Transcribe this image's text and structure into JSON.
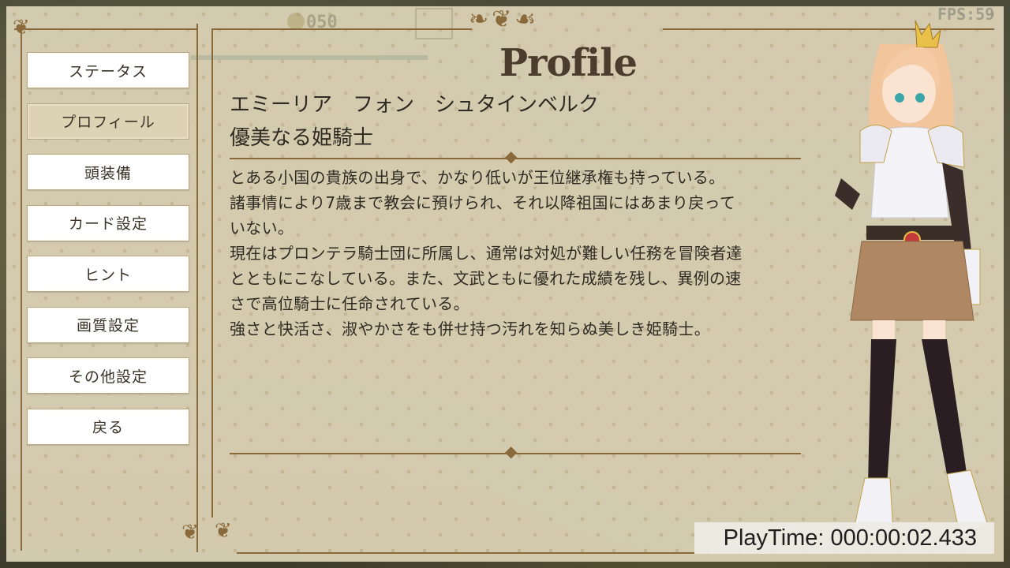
{
  "hud": {
    "coins": "050",
    "fps": "FPS:59"
  },
  "menu": {
    "items": [
      {
        "label": "ステータス",
        "active": false
      },
      {
        "label": "プロフィール",
        "active": true
      },
      {
        "label": "頭装備",
        "active": false
      },
      {
        "label": "カード設定",
        "active": false
      },
      {
        "label": "ヒント",
        "active": false
      },
      {
        "label": "画質設定",
        "active": false
      },
      {
        "label": "その他設定",
        "active": false
      },
      {
        "label": "戻る",
        "active": false
      }
    ]
  },
  "profile": {
    "heading": "Profile",
    "name": "エミーリア　フォン　シュタインベルク",
    "title": "優美なる姫騎士",
    "description": [
      "とある小国の貴族の出身で、かなり低いが王位継承権も持っている。",
      "諸事情により7歳まで教会に預けられ、それ以降祖国にはあまり戻って",
      "いない。",
      "現在はプロンテラ騎士団に所属し、通常は対処が難しい任務を冒険者達",
      "とともにこなしている。また、文武ともに優れた成績を残し、異例の速",
      "さで高位騎士に任命されている。",
      "強さと快活さ、淑やかさをも併せ持つ汚れを知らぬ美しき姫騎士。"
    ]
  },
  "playtime": "PlayTime: 000:00:02.433",
  "colors": {
    "frame": "#8a6a3a",
    "parchment": "#d9d0b4",
    "active_button": "#dcd2b4"
  }
}
